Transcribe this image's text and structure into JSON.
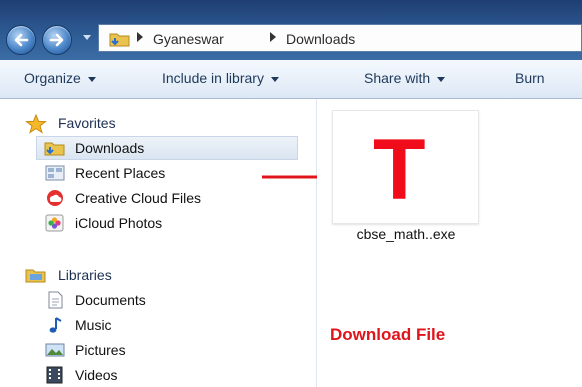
{
  "breadcrumb": [
    "Gyaneswar",
    "Downloads"
  ],
  "toolbar": {
    "organize": "Organize",
    "include_in_library": "Include in library",
    "share_with": "Share with",
    "burn": "Burn"
  },
  "nav": {
    "favorites": "Favorites",
    "favorites_items": [
      "Downloads",
      "Recent Places",
      "Creative Cloud Files",
      "iCloud Photos"
    ],
    "libraries": "Libraries",
    "libraries_items": [
      "Documents",
      "Music",
      "Pictures",
      "Videos"
    ]
  },
  "file": {
    "name": "cbse_math..exe",
    "icon_letter": "T"
  },
  "annotation": "Download File",
  "colors": {
    "accent_red": "#e0141b",
    "selection": "#dae5f1"
  }
}
